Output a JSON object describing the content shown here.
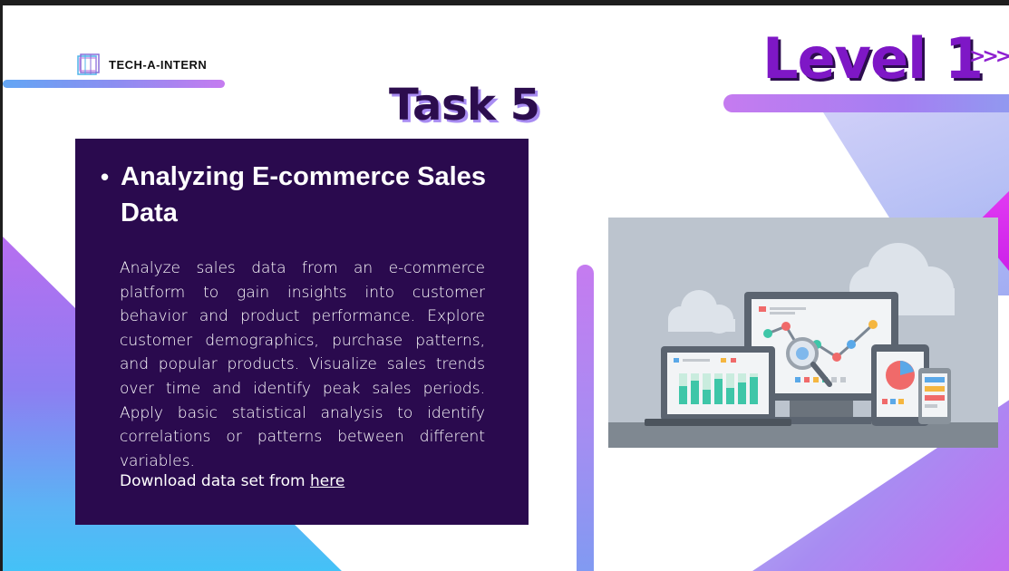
{
  "brand": {
    "logo_text": "TECH-A-INTERN",
    "icon": "stacked-squares-logo-icon"
  },
  "header": {
    "level": "Level 1",
    "arrows": ">>>",
    "task": "Task 5"
  },
  "card": {
    "bullet": "•",
    "title": "Analyzing E-commerce Sales Data",
    "body": "Analyze sales data from an e-commerce platform to gain insights into customer behavior and product performance. Explore customer demographics, purchase patterns, and popular products. Visualize sales trends over time and identify peak sales periods. Apply basic statistical analysis to identify correlations or patterns between different variables.",
    "download_prefix": "Download data set from",
    "download_link": "here"
  },
  "illustration": {
    "icon": "analytics-devices-illustration"
  },
  "colors": {
    "card_bg": "#2a0a4e",
    "level_purple": "#7e17c6",
    "task_dark": "#2c0d4e",
    "accent_gradient_start": "#c57bf0",
    "accent_gradient_end": "#5ab4f5"
  }
}
